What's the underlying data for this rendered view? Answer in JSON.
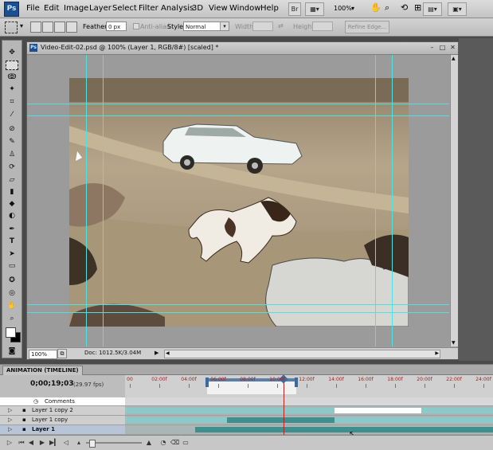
{
  "app": {
    "logo": "Ps"
  },
  "menu": [
    "File",
    "Edit",
    "Image",
    "Layer",
    "Select",
    "Filter",
    "Analysis",
    "3D",
    "View",
    "Window",
    "Help"
  ],
  "toolbar": {
    "br_label": "Br",
    "zoom": "100%"
  },
  "options": {
    "feather_label": "Feather:",
    "feather_value": "0 px",
    "antialias_label": "Anti-alias",
    "style_label": "Style:",
    "style_value": "Normal",
    "width_label": "Width:",
    "height_label": "Height:",
    "refine_label": "Refine Edge..."
  },
  "document": {
    "title": "Video-Edit-02.psd @ 100% (Layer 1, RGB/8#) [scaled] *",
    "zoom": "100%",
    "doc_info": "Doc: 1012.5K/3.04M"
  },
  "animation": {
    "tab": "ANIMATION (TIMELINE)",
    "timecode": "0;00;19;03",
    "fps": "(29.97 fps)",
    "ruler": [
      "00",
      "02:00f",
      "04:00f",
      "06:00f",
      "08:00f",
      "10:00f",
      "12:00f",
      "14:00f",
      "16:00f",
      "18:00f",
      "20:00f",
      "22:00f",
      "24:00f"
    ],
    "comments_label": "Comments",
    "layers": [
      {
        "name": "Layer 1 copy 2"
      },
      {
        "name": "Layer 1 copy"
      },
      {
        "name": "Layer 1"
      }
    ]
  },
  "colors": {
    "guide": "#4fe0e0",
    "accent": "#3b6ea6",
    "playhead": "#b2242a",
    "track_fill": "#7fbdbd"
  }
}
